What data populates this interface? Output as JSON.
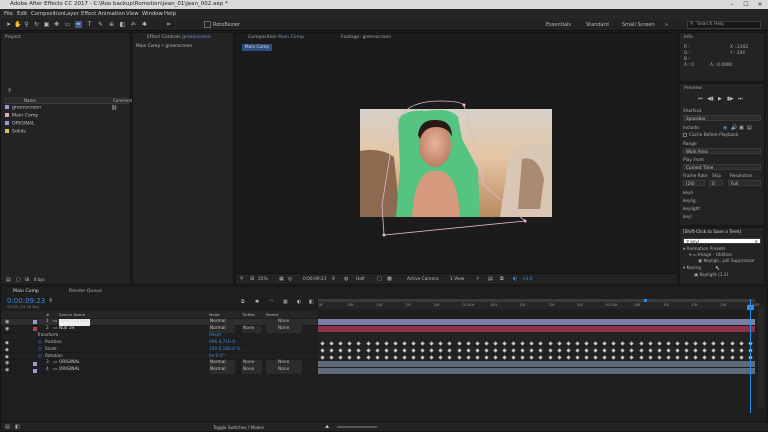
{
  "window": {
    "title": "Adobe After Effects CC 2017 - C:\\Roo backup\\Romotion\\jean_01\\jean_002.aep *",
    "minimize": "–",
    "maximize": "☐",
    "close": "✕"
  },
  "menu": [
    "File",
    "Edit",
    "Composition",
    "Layer",
    "Effect",
    "Animation",
    "View",
    "Window",
    "Help"
  ],
  "toolbar": {
    "roto": "RotoBezier",
    "workspaces": [
      "Essentials",
      "Standard",
      "Small Screen"
    ],
    "search_placeholder": "Search Help"
  },
  "project": {
    "tab": "Project",
    "col_name": "Name",
    "col_type": "Type",
    "col_icon": "Comment",
    "items": [
      {
        "name": "greenscreen",
        "color": "#9a9ad8"
      },
      {
        "name": "Main Comp",
        "color": "#d8a7c8"
      },
      {
        "name": "ORIGINAL",
        "color": "#9a9ad8"
      },
      {
        "name": "Solids",
        "color": "#d8c24a"
      }
    ],
    "bpc": "8 bpc"
  },
  "effect_controls": {
    "tab_prefix": "Effect Controls",
    "tab_layer": "greenscreen",
    "breadcrumb": "Main Comp • greenscreen"
  },
  "composition": {
    "tab_prefix": "Composition",
    "tab_comp": "Main Comp",
    "footage_tab": "Footage: greenscreen",
    "subtab": "Main Comp"
  },
  "viewer_bar": {
    "zoom": "25%",
    "timecode": "0:00:09:23",
    "resolution": "Half",
    "camera": "Active Camera",
    "views": "1 View",
    "exposure": "+0.0"
  },
  "info": {
    "tab": "Info",
    "r": "R :",
    "g": "G :",
    "b": "B :",
    "a": "A : 0",
    "x": "X : 2102",
    "y": "Y : 294",
    "alpha": "A : 0.0000"
  },
  "preview": {
    "tab": "Preview",
    "shortcut_label": "Shortcut",
    "shortcut_value": "Spacebar",
    "include_label": "Include:",
    "cache_label": "Cache Before Playback",
    "range_label": "Range",
    "range_value": "Work Area",
    "play_from_label": "Play From",
    "play_from_value": "Current Time",
    "frame_rate_label": "Frame Rate",
    "skip_label": "Skip",
    "resolution_label": "Resolution",
    "frame_rate_value": "(24)",
    "skip_value": "0",
    "resolution_value": "Full"
  },
  "effects_list": [
    "keyli",
    "keylig",
    "keylight",
    "keyl"
  ],
  "effects_presets": {
    "hint": "[Shift-Click to Save a Term]",
    "search": "keyl",
    "items": [
      {
        "label": "Animation Presets",
        "level": 0
      },
      {
        "label": "Image - Utilities",
        "level": 1
      },
      {
        "label": "Keyligh...pill Suppressor",
        "level": 2
      },
      {
        "label": "Keying",
        "level": 0
      },
      {
        "label": "Keylight (1.2)",
        "level": 1
      }
    ]
  },
  "timeline": {
    "comp_tab": "Main Comp",
    "render_tab": "Render Queue",
    "timecode": "0:00:09:23",
    "fps": "00239 (24.00 fps)",
    "headers": {
      "num": "#",
      "source": "Source Name",
      "mode": "Mode",
      "trkmat": "TrkMat",
      "parent": "Parent"
    },
    "layers": [
      {
        "num": "1",
        "name": "greenscreen",
        "mode": "Normal",
        "trkmat": "",
        "parent": "None",
        "color": "#9a9ad8",
        "selected": true
      },
      {
        "num": "2",
        "name": "Null 19",
        "mode": "Normal",
        "trkmat": "None",
        "parent": "None",
        "color": "#b04052",
        "selected": false
      },
      {
        "num": "",
        "name": "Transform",
        "mode": "Reset",
        "trkmat": "",
        "parent": "",
        "color": "",
        "selected": false
      },
      {
        "num": "",
        "name": "Position",
        "mode": "996.0,710.0",
        "trkmat": "",
        "parent": "",
        "color": "",
        "selected": false
      },
      {
        "num": "",
        "name": "Scale",
        "mode": "100.0,100.0 %",
        "trkmat": "",
        "parent": "",
        "color": "",
        "selected": false
      },
      {
        "num": "",
        "name": "Rotation",
        "mode": "0x-0.0°",
        "trkmat": "",
        "parent": "",
        "color": "",
        "selected": false
      },
      {
        "num": "3",
        "name": "ORIGINAL",
        "mode": "Normal",
        "trkmat": "None",
        "parent": "None",
        "color": "#9a9ad8",
        "selected": false
      },
      {
        "num": "4",
        "name": "ORIGINAL",
        "mode": "Normal",
        "trkmat": "None",
        "parent": "None",
        "color": "#9a9ad8",
        "selected": false
      }
    ],
    "ruler": [
      "0f",
      "05f",
      "10f",
      "15f",
      "20f",
      "01:00f",
      "05f",
      "10f",
      "15f",
      "20f",
      "02:00f",
      "05f",
      "10f",
      "15f",
      "20f",
      "03:00"
    ],
    "toggle_label": "Toggle Switches / Modes"
  },
  "colors": {
    "accent": "#2d8ceb",
    "timecode": "#3b8cd9",
    "green_screen": "#54c480",
    "null_bar": "#8e3347"
  }
}
